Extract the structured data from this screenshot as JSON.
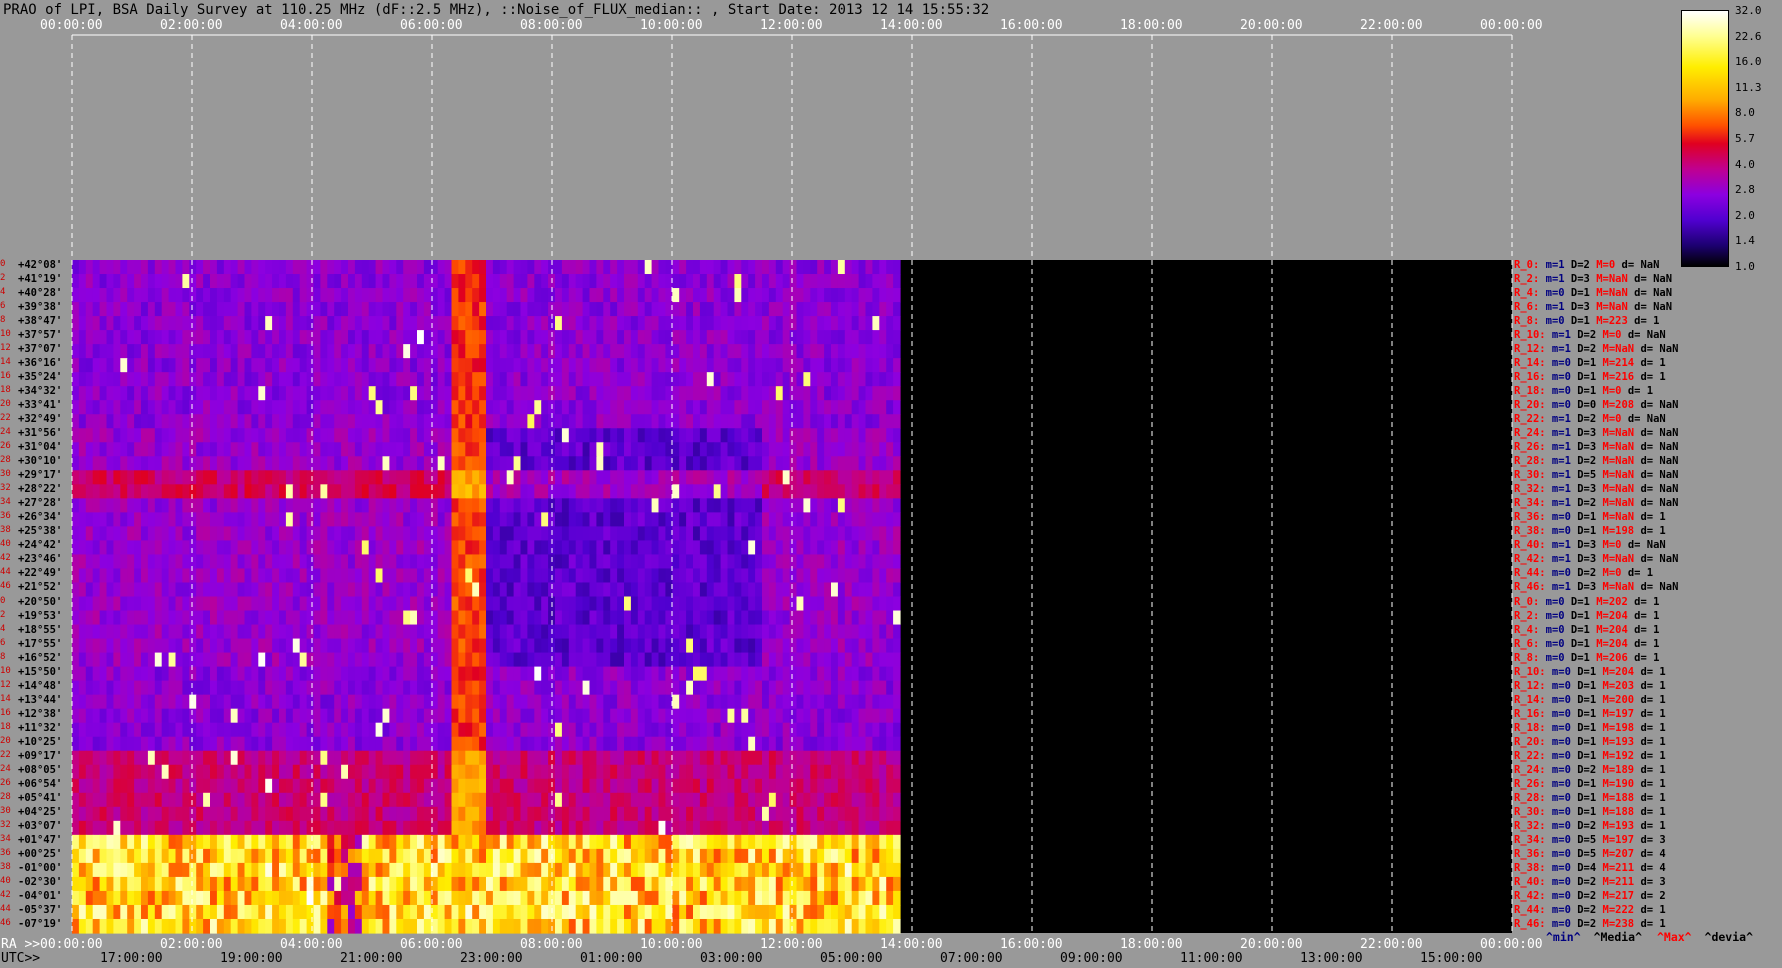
{
  "title": "PRAO of LPI, BSA Daily Survey at 110.25 MHz (dF::2.5 MHz), ::Noise_of_FLUX_median:: , Start Date: 2013 12 14 15:55:32",
  "top_axis_ticks": [
    "00:00:00",
    "02:00:00",
    "04:00:00",
    "06:00:00",
    "08:00:00",
    "10:00:00",
    "12:00:00",
    "14:00:00",
    "16:00:00",
    "18:00:00",
    "20:00:00",
    "22:00:00",
    "00:00:00"
  ],
  "ra_axis": {
    "label": "RA >>",
    "ticks": [
      "00:00:00",
      "02:00:00",
      "04:00:00",
      "06:00:00",
      "08:00:00",
      "10:00:00",
      "12:00:00",
      "14:00:00",
      "16:00:00",
      "18:00:00",
      "20:00:00",
      "22:00:00",
      "00:00:00"
    ]
  },
  "utc_axis": {
    "label": "UTC>>",
    "ticks": [
      "17:00:00",
      "19:00:00",
      "21:00:00",
      "23:00:00",
      "01:00:00",
      "03:00:00",
      "05:00:00",
      "07:00:00",
      "09:00:00",
      "11:00:00",
      "13:00:00",
      "15:00:00"
    ]
  },
  "colorbar": {
    "labels": [
      "32.0",
      "22.6",
      "16.0",
      "11.3",
      "8.0",
      "5.7",
      "4.0",
      "2.8",
      "2.0",
      "1.4",
      "1.0"
    ]
  },
  "legend": [
    "^min^",
    "^Media^",
    "^Max^",
    "^devia^"
  ],
  "chart_data": {
    "type": "heatmap",
    "title": "PRAO of LPI, BSA Daily Survey at 110.25 MHz (dF::2.5 MHz), ::Noise_of_FLUX_median:: , Start Date: 2013 12 14 15:55:32",
    "x_axis": "RA / UTC",
    "xlim_ra_hours": [
      0,
      24
    ],
    "data_extent_ra_hours": [
      0,
      13.8
    ],
    "scale_min": 1.0,
    "scale_max": 32.0,
    "rows": [
      {
        "idx": "0",
        "dec": "+42°08'"
      },
      {
        "idx": "2",
        "dec": "+41°19'"
      },
      {
        "idx": "4",
        "dec": "+40°28'"
      },
      {
        "idx": "6",
        "dec": "+39°38'"
      },
      {
        "idx": "8",
        "dec": "+38°47'"
      },
      {
        "idx": "10",
        "dec": "+37°57'"
      },
      {
        "idx": "12",
        "dec": "+37°07'"
      },
      {
        "idx": "14",
        "dec": "+36°16'"
      },
      {
        "idx": "16",
        "dec": "+35°24'"
      },
      {
        "idx": "18",
        "dec": "+34°32'"
      },
      {
        "idx": "20",
        "dec": "+33°41'"
      },
      {
        "idx": "22",
        "dec": "+32°49'"
      },
      {
        "idx": "24",
        "dec": "+31°56'"
      },
      {
        "idx": "26",
        "dec": "+31°04'"
      },
      {
        "idx": "28",
        "dec": "+30°10'"
      },
      {
        "idx": "30",
        "dec": "+29°17'"
      },
      {
        "idx": "32",
        "dec": "+28°22'"
      },
      {
        "idx": "34",
        "dec": "+27°28'"
      },
      {
        "idx": "36",
        "dec": "+26°34'"
      },
      {
        "idx": "38",
        "dec": "+25°38'"
      },
      {
        "idx": "40",
        "dec": "+24°42'"
      },
      {
        "idx": "42",
        "dec": "+23°46'"
      },
      {
        "idx": "44",
        "dec": "+22°49'"
      },
      {
        "idx": "46",
        "dec": "+21°52'"
      },
      {
        "idx": "0",
        "dec": "+20°50'"
      },
      {
        "idx": "2",
        "dec": "+19°53'"
      },
      {
        "idx": "4",
        "dec": "+18°55'"
      },
      {
        "idx": "6",
        "dec": "+17°55'"
      },
      {
        "idx": "8",
        "dec": "+16°52'"
      },
      {
        "idx": "10",
        "dec": "+15°50'"
      },
      {
        "idx": "12",
        "dec": "+14°48'"
      },
      {
        "idx": "14",
        "dec": "+13°44'"
      },
      {
        "idx": "16",
        "dec": "+12°38'"
      },
      {
        "idx": "18",
        "dec": "+11°32'"
      },
      {
        "idx": "20",
        "dec": "+10°25'"
      },
      {
        "idx": "22",
        "dec": "+09°17'"
      },
      {
        "idx": "24",
        "dec": "+08°05'"
      },
      {
        "idx": "26",
        "dec": "+06°54'"
      },
      {
        "idx": "28",
        "dec": "+05°41'"
      },
      {
        "idx": "30",
        "dec": "+04°25'"
      },
      {
        "idx": "32",
        "dec": "+03°07'"
      },
      {
        "idx": "34",
        "dec": "+01°47'"
      },
      {
        "idx": "36",
        "dec": "+00°25'"
      },
      {
        "idx": "38",
        "dec": "-01°00'"
      },
      {
        "idx": "40",
        "dec": "-02°30'"
      },
      {
        "idx": "42",
        "dec": "-04°01'"
      },
      {
        "idx": "44",
        "dec": "-05°37'"
      },
      {
        "idx": "46",
        "dec": "-07°19'"
      }
    ],
    "stats": [
      {
        "r": "R_0:",
        "m": "m=1",
        "D": "D=2",
        "M": "M=0",
        "d": "d= NaN"
      },
      {
        "r": "R_2:",
        "m": "m=1",
        "D": "D=3",
        "M": "M=NaN",
        "d": "d= NaN"
      },
      {
        "r": "R_4:",
        "m": "m=0",
        "D": "D=1",
        "M": "M=NaN",
        "d": "d= NaN"
      },
      {
        "r": "R_6:",
        "m": "m=1",
        "D": "D=3",
        "M": "M=NaN",
        "d": "d= NaN"
      },
      {
        "r": "R_8:",
        "m": "m=0",
        "D": "D=1",
        "M": "M=223",
        "d": "d= 1"
      },
      {
        "r": "R_10:",
        "m": "m=1",
        "D": "D=2",
        "M": "M=0",
        "d": "d= NaN"
      },
      {
        "r": "R_12:",
        "m": "m=1",
        "D": "D=2",
        "M": "M=NaN",
        "d": "d= NaN"
      },
      {
        "r": "R_14:",
        "m": "m=0",
        "D": "D=1",
        "M": "M=214",
        "d": "d= 1"
      },
      {
        "r": "R_16:",
        "m": "m=0",
        "D": "D=1",
        "M": "M=216",
        "d": "d= 1"
      },
      {
        "r": "R_18:",
        "m": "m=0",
        "D": "D=1",
        "M": "M=0",
        "d": "d= 1"
      },
      {
        "r": "R_20:",
        "m": "m=0",
        "D": "D=0",
        "M": "M=208",
        "d": "d= NaN"
      },
      {
        "r": "R_22:",
        "m": "m=1",
        "D": "D=2",
        "M": "M=0",
        "d": "d= NaN"
      },
      {
        "r": "R_24:",
        "m": "m=1",
        "D": "D=3",
        "M": "M=NaN",
        "d": "d= NaN"
      },
      {
        "r": "R_26:",
        "m": "m=1",
        "D": "D=3",
        "M": "M=NaN",
        "d": "d= NaN"
      },
      {
        "r": "R_28:",
        "m": "m=1",
        "D": "D=2",
        "M": "M=NaN",
        "d": "d= NaN"
      },
      {
        "r": "R_30:",
        "m": "m=1",
        "D": "D=5",
        "M": "M=NaN",
        "d": "d= NaN"
      },
      {
        "r": "R_32:",
        "m": "m=1",
        "D": "D=3",
        "M": "M=NaN",
        "d": "d= NaN"
      },
      {
        "r": "R_34:",
        "m": "m=1",
        "D": "D=2",
        "M": "M=NaN",
        "d": "d= NaN"
      },
      {
        "r": "R_36:",
        "m": "m=0",
        "D": "D=1",
        "M": "M=NaN",
        "d": "d= 1"
      },
      {
        "r": "R_38:",
        "m": "m=0",
        "D": "D=1",
        "M": "M=198",
        "d": "d= 1"
      },
      {
        "r": "R_40:",
        "m": "m=1",
        "D": "D=3",
        "M": "M=0",
        "d": "d= NaN"
      },
      {
        "r": "R_42:",
        "m": "m=1",
        "D": "D=3",
        "M": "M=NaN",
        "d": "d= NaN"
      },
      {
        "r": "R_44:",
        "m": "m=0",
        "D": "D=2",
        "M": "M=0",
        "d": "d= 1"
      },
      {
        "r": "R_46:",
        "m": "m=1",
        "D": "D=3",
        "M": "M=NaN",
        "d": "d= NaN"
      },
      {
        "r": "R_0:",
        "m": "m=0",
        "D": "D=1",
        "M": "M=202",
        "d": "d= 1"
      },
      {
        "r": "R_2:",
        "m": "m=0",
        "D": "D=1",
        "M": "M=204",
        "d": "d= 1"
      },
      {
        "r": "R_4:",
        "m": "m=0",
        "D": "D=1",
        "M": "M=204",
        "d": "d= 1"
      },
      {
        "r": "R_6:",
        "m": "m=0",
        "D": "D=1",
        "M": "M=204",
        "d": "d= 1"
      },
      {
        "r": "R_8:",
        "m": "m=0",
        "D": "D=1",
        "M": "M=206",
        "d": "d= 1"
      },
      {
        "r": "R_10:",
        "m": "m=0",
        "D": "D=1",
        "M": "M=204",
        "d": "d= 1"
      },
      {
        "r": "R_12:",
        "m": "m=0",
        "D": "D=1",
        "M": "M=203",
        "d": "d= 1"
      },
      {
        "r": "R_14:",
        "m": "m=0",
        "D": "D=1",
        "M": "M=200",
        "d": "d= 1"
      },
      {
        "r": "R_16:",
        "m": "m=0",
        "D": "D=1",
        "M": "M=197",
        "d": "d= 1"
      },
      {
        "r": "R_18:",
        "m": "m=0",
        "D": "D=1",
        "M": "M=198",
        "d": "d= 1"
      },
      {
        "r": "R_20:",
        "m": "m=0",
        "D": "D=1",
        "M": "M=193",
        "d": "d= 1"
      },
      {
        "r": "R_22:",
        "m": "m=0",
        "D": "D=1",
        "M": "M=192",
        "d": "d= 1"
      },
      {
        "r": "R_24:",
        "m": "m=0",
        "D": "D=2",
        "M": "M=189",
        "d": "d= 1"
      },
      {
        "r": "R_26:",
        "m": "m=0",
        "D": "D=1",
        "M": "M=190",
        "d": "d= 1"
      },
      {
        "r": "R_28:",
        "m": "m=0",
        "D": "D=1",
        "M": "M=188",
        "d": "d= 1"
      },
      {
        "r": "R_30:",
        "m": "m=0",
        "D": "D=1",
        "M": "M=188",
        "d": "d= 1"
      },
      {
        "r": "R_32:",
        "m": "m=0",
        "D": "D=2",
        "M": "M=193",
        "d": "d= 1"
      },
      {
        "r": "R_34:",
        "m": "m=0",
        "D": "D=5",
        "M": "M=197",
        "d": "d= 3"
      },
      {
        "r": "R_36:",
        "m": "m=0",
        "D": "D=5",
        "M": "M=207",
        "d": "d= 4"
      },
      {
        "r": "R_38:",
        "m": "m=0",
        "D": "D=4",
        "M": "M=211",
        "d": "d= 4"
      },
      {
        "r": "R_40:",
        "m": "m=0",
        "D": "D=2",
        "M": "M=211",
        "d": "d= 3"
      },
      {
        "r": "R_42:",
        "m": "m=0",
        "D": "D=2",
        "M": "M=217",
        "d": "d= 2"
      },
      {
        "r": "R_44:",
        "m": "m=0",
        "D": "D=2",
        "M": "M=222",
        "d": "d= 1"
      },
      {
        "r": "R_46:",
        "m": "m=0",
        "D": "D=2",
        "M": "M=238",
        "d": "d= 1"
      }
    ]
  }
}
